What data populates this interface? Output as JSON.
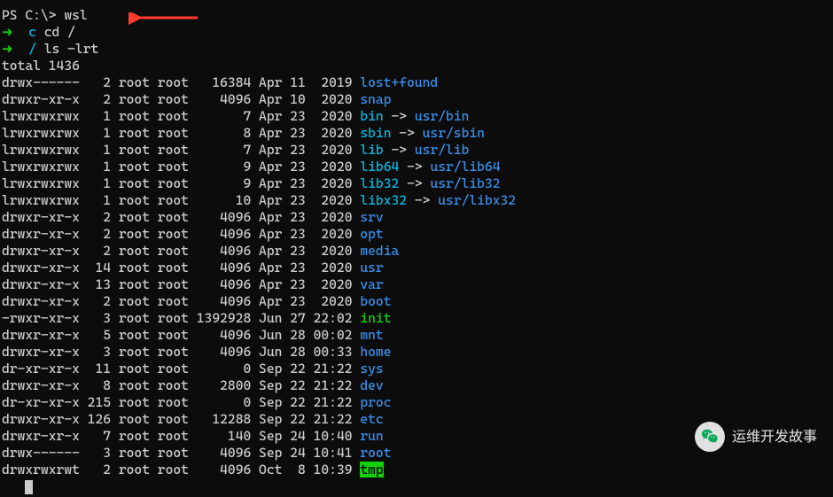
{
  "prompt": {
    "ps_prefix": "PS C:\\>",
    "ps_cmd": "wsl",
    "arrow": "➜",
    "wsl_c": "c",
    "cd_cmd": "cd /",
    "wsl_slash": "/",
    "ls_cmd": "ls -lrt"
  },
  "total_line": "total 1436",
  "rows": [
    {
      "perm": "drwx------",
      "lnk": "2",
      "own": "root",
      "grp": "root",
      "size": "16384",
      "mon": "Apr",
      "day": "11",
      "time": "2019",
      "name": "lost+found",
      "cls": "blue",
      "target": null,
      "tcls": null
    },
    {
      "perm": "drwxr-xr-x",
      "lnk": "2",
      "own": "root",
      "grp": "root",
      "size": "4096",
      "mon": "Apr",
      "day": "10",
      "time": "2020",
      "name": "snap",
      "cls": "blue",
      "target": null,
      "tcls": null
    },
    {
      "perm": "lrwxrwxrwx",
      "lnk": "1",
      "own": "root",
      "grp": "root",
      "size": "7",
      "mon": "Apr",
      "day": "23",
      "time": "2020",
      "name": "bin",
      "cls": "cyan",
      "target": "usr/bin",
      "tcls": "blue"
    },
    {
      "perm": "lrwxrwxrwx",
      "lnk": "1",
      "own": "root",
      "grp": "root",
      "size": "8",
      "mon": "Apr",
      "day": "23",
      "time": "2020",
      "name": "sbin",
      "cls": "cyan",
      "target": "usr/sbin",
      "tcls": "blue"
    },
    {
      "perm": "lrwxrwxrwx",
      "lnk": "1",
      "own": "root",
      "grp": "root",
      "size": "7",
      "mon": "Apr",
      "day": "23",
      "time": "2020",
      "name": "lib",
      "cls": "cyan",
      "target": "usr/lib",
      "tcls": "blue"
    },
    {
      "perm": "lrwxrwxrwx",
      "lnk": "1",
      "own": "root",
      "grp": "root",
      "size": "9",
      "mon": "Apr",
      "day": "23",
      "time": "2020",
      "name": "lib64",
      "cls": "cyan",
      "target": "usr/lib64",
      "tcls": "blue"
    },
    {
      "perm": "lrwxrwxrwx",
      "lnk": "1",
      "own": "root",
      "grp": "root",
      "size": "9",
      "mon": "Apr",
      "day": "23",
      "time": "2020",
      "name": "lib32",
      "cls": "cyan",
      "target": "usr/lib32",
      "tcls": "blue"
    },
    {
      "perm": "lrwxrwxrwx",
      "lnk": "1",
      "own": "root",
      "grp": "root",
      "size": "10",
      "mon": "Apr",
      "day": "23",
      "time": "2020",
      "name": "libx32",
      "cls": "cyan",
      "target": "usr/libx32",
      "tcls": "blue"
    },
    {
      "perm": "drwxr-xr-x",
      "lnk": "2",
      "own": "root",
      "grp": "root",
      "size": "4096",
      "mon": "Apr",
      "day": "23",
      "time": "2020",
      "name": "srv",
      "cls": "blue",
      "target": null,
      "tcls": null
    },
    {
      "perm": "drwxr-xr-x",
      "lnk": "2",
      "own": "root",
      "grp": "root",
      "size": "4096",
      "mon": "Apr",
      "day": "23",
      "time": "2020",
      "name": "opt",
      "cls": "blue",
      "target": null,
      "tcls": null
    },
    {
      "perm": "drwxr-xr-x",
      "lnk": "2",
      "own": "root",
      "grp": "root",
      "size": "4096",
      "mon": "Apr",
      "day": "23",
      "time": "2020",
      "name": "media",
      "cls": "blue",
      "target": null,
      "tcls": null
    },
    {
      "perm": "drwxr-xr-x",
      "lnk": "14",
      "own": "root",
      "grp": "root",
      "size": "4096",
      "mon": "Apr",
      "day": "23",
      "time": "2020",
      "name": "usr",
      "cls": "blue",
      "target": null,
      "tcls": null
    },
    {
      "perm": "drwxr-xr-x",
      "lnk": "13",
      "own": "root",
      "grp": "root",
      "size": "4096",
      "mon": "Apr",
      "day": "23",
      "time": "2020",
      "name": "var",
      "cls": "blue",
      "target": null,
      "tcls": null
    },
    {
      "perm": "drwxr-xr-x",
      "lnk": "2",
      "own": "root",
      "grp": "root",
      "size": "4096",
      "mon": "Apr",
      "day": "23",
      "time": "2020",
      "name": "boot",
      "cls": "blue",
      "target": null,
      "tcls": null
    },
    {
      "perm": "-rwxr-xr-x",
      "lnk": "3",
      "own": "root",
      "grp": "root",
      "size": "1392928",
      "mon": "Jun",
      "day": "27",
      "time": "22:02",
      "name": "init",
      "cls": "green",
      "target": null,
      "tcls": null
    },
    {
      "perm": "drwxr-xr-x",
      "lnk": "5",
      "own": "root",
      "grp": "root",
      "size": "4096",
      "mon": "Jun",
      "day": "28",
      "time": "00:02",
      "name": "mnt",
      "cls": "blue",
      "target": null,
      "tcls": null
    },
    {
      "perm": "drwxr-xr-x",
      "lnk": "3",
      "own": "root",
      "grp": "root",
      "size": "4096",
      "mon": "Jun",
      "day": "28",
      "time": "00:33",
      "name": "home",
      "cls": "blue",
      "target": null,
      "tcls": null
    },
    {
      "perm": "dr-xr-xr-x",
      "lnk": "11",
      "own": "root",
      "grp": "root",
      "size": "0",
      "mon": "Sep",
      "day": "22",
      "time": "21:22",
      "name": "sys",
      "cls": "blue",
      "target": null,
      "tcls": null
    },
    {
      "perm": "drwxr-xr-x",
      "lnk": "8",
      "own": "root",
      "grp": "root",
      "size": "2800",
      "mon": "Sep",
      "day": "22",
      "time": "21:22",
      "name": "dev",
      "cls": "blue",
      "target": null,
      "tcls": null
    },
    {
      "perm": "dr-xr-xr-x",
      "lnk": "215",
      "own": "root",
      "grp": "root",
      "size": "0",
      "mon": "Sep",
      "day": "22",
      "time": "21:22",
      "name": "proc",
      "cls": "blue",
      "target": null,
      "tcls": null
    },
    {
      "perm": "drwxr-xr-x",
      "lnk": "126",
      "own": "root",
      "grp": "root",
      "size": "12288",
      "mon": "Sep",
      "day": "22",
      "time": "21:22",
      "name": "etc",
      "cls": "blue",
      "target": null,
      "tcls": null
    },
    {
      "perm": "drwxr-xr-x",
      "lnk": "7",
      "own": "root",
      "grp": "root",
      "size": "140",
      "mon": "Sep",
      "day": "24",
      "time": "10:40",
      "name": "run",
      "cls": "blue",
      "target": null,
      "tcls": null
    },
    {
      "perm": "drwx------",
      "lnk": "3",
      "own": "root",
      "grp": "root",
      "size": "4096",
      "mon": "Sep",
      "day": "24",
      "time": "10:41",
      "name": "root",
      "cls": "blue",
      "target": null,
      "tcls": null
    },
    {
      "perm": "drwxrwxrwt",
      "lnk": "2",
      "own": "root",
      "grp": "root",
      "size": "4096",
      "mon": "Oct",
      "day": "8",
      "time": "10:39",
      "name": "tmp",
      "cls": "hl-tmp",
      "target": null,
      "tcls": null
    }
  ],
  "symlink_arrow": " -> ",
  "watermark_text": "运维开发故事"
}
